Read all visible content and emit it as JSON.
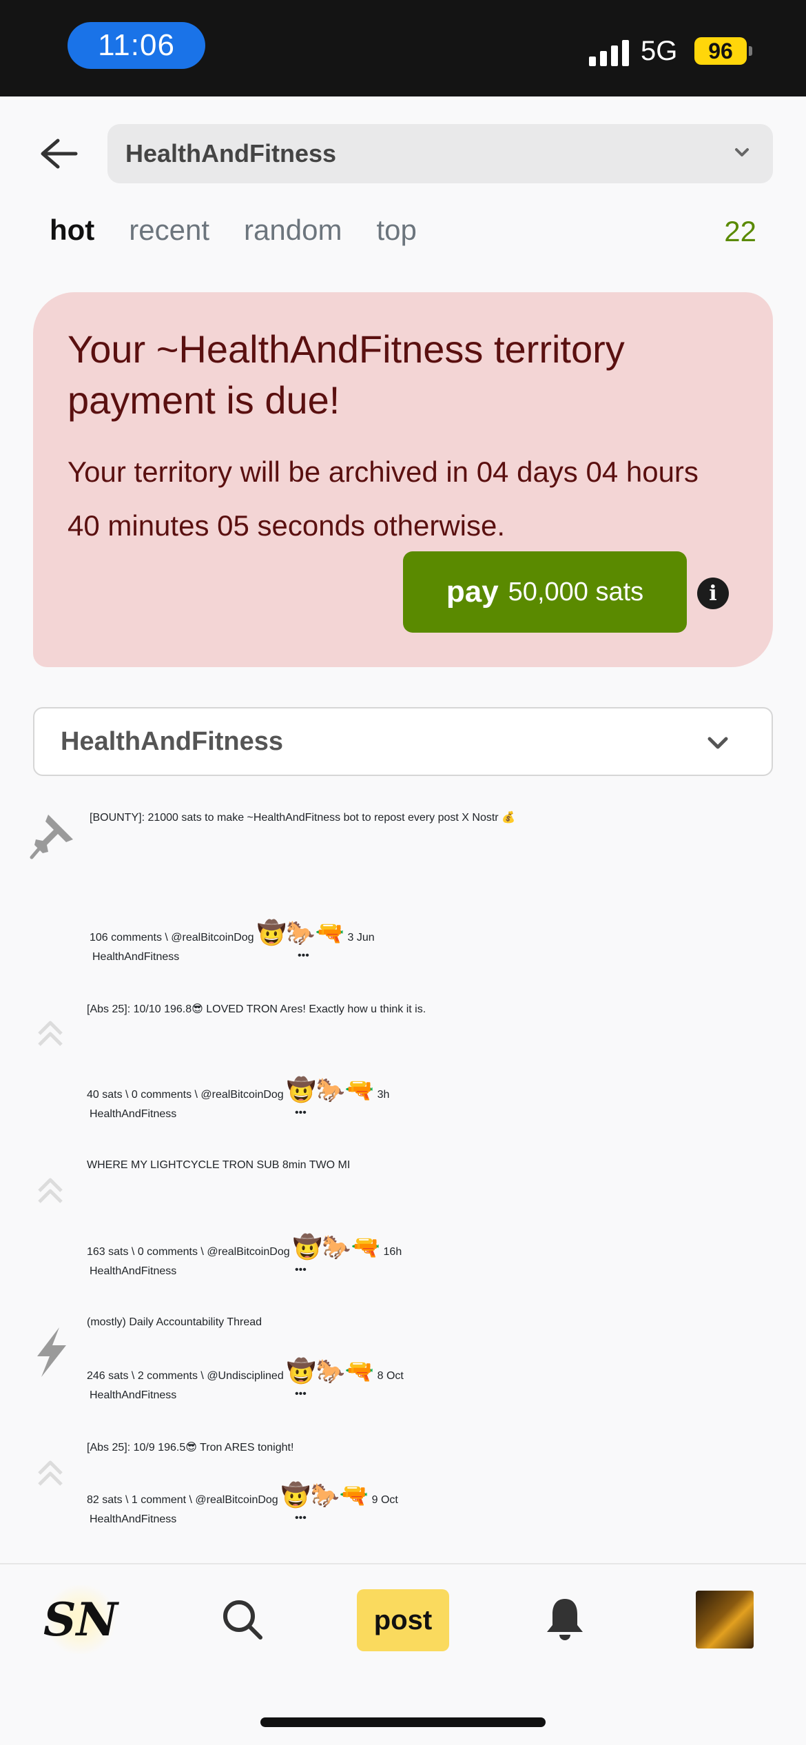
{
  "status_bar": {
    "time": "11:06",
    "network": "5G",
    "battery": "96"
  },
  "header": {
    "subselect": "HealthAndFitness"
  },
  "tabs": [
    {
      "label": "hot"
    },
    {
      "label": "recent"
    },
    {
      "label": "random"
    },
    {
      "label": "top"
    }
  ],
  "tab_count": "22",
  "alert": {
    "title": "Your ~HealthAndFitness territory payment is due!",
    "text": "Your territory will be archived in 04 days 04 hours 40 minutes 05 seconds otherwise.",
    "pay_word": "pay",
    "pay_amount": "50,000 sats"
  },
  "sub_select": "HealthAndFitness",
  "items": [
    {
      "title": "[BOUNTY]: 21000 sats to make ~HealthAndFitness bot to repost every post X Nostr 💰",
      "icon": "pin-icon",
      "stats": "106 comments \\",
      "author": "@realBitcoinDog",
      "time": "3 Jun",
      "badge": "HealthAndFitness",
      "more": "•••"
    },
    {
      "title": "[Abs 25]: 10/10 196.8😎 LOVED TRON Ares! Exactly how u think it is.",
      "icon": "upvote-icon",
      "stats": "40 sats \\ 0 comments \\",
      "author": "@realBitcoinDog",
      "time": "3h",
      "badge": "HealthAndFitness",
      "more": "•••"
    },
    {
      "title": "WHERE MY LIGHTCYCLE TRON SUB 8min TWO MI",
      "icon": "upvote-icon",
      "stats": "163 sats \\ 0 comments \\",
      "author": "@realBitcoinDog",
      "time": "16h",
      "badge": "HealthAndFitness",
      "more": "•••"
    },
    {
      "title": "(mostly) Daily Accountability Thread",
      "icon": "bolt-icon",
      "stats": "246 sats \\ 2 comments \\",
      "author": "@Undisciplined",
      "time": "8 Oct",
      "badge": "HealthAndFitness",
      "more": "•••"
    },
    {
      "title": "[Abs 25]: 10/9 196.5😎 Tron ARES tonight!",
      "icon": "upvote-icon",
      "stats": "82 sats \\ 1 comment \\",
      "author": "@realBitcoinDog",
      "time": "9 Oct",
      "badge": "HealthAndFitness",
      "more": "•••"
    }
  ],
  "hats": "🤠🐎🔫",
  "nav": {
    "logo": "SN",
    "post": "post"
  }
}
